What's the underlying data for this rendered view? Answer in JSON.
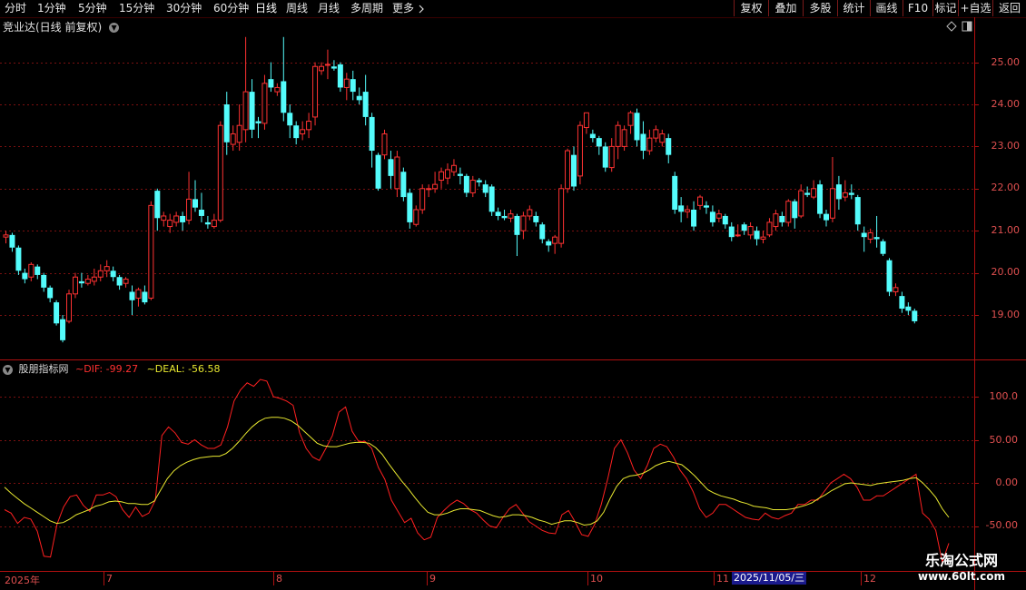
{
  "toolbar": {
    "periods": [
      "分时",
      "1分钟",
      "5分钟",
      "15分钟",
      "30分钟",
      "60分钟",
      "日线",
      "周线",
      "月线",
      "多周期",
      "更多"
    ],
    "active_period": "日线",
    "more_icon": "chevron-right-icon",
    "right_buttons": [
      "复权",
      "叠加",
      "多股",
      "统计",
      "画线",
      "F10",
      "标记",
      "+自选",
      "返回"
    ]
  },
  "stock": {
    "title": "竞业达(日线 前复权)",
    "title_icon": "chevron-down-icon"
  },
  "indicator": {
    "name": "股朋指标网",
    "dif_label": "~DIF: -99.27",
    "deal_label": "~DEAL: -56.58"
  },
  "price_axis": [
    "25.00",
    "24.00",
    "23.00",
    "22.00",
    "21.00",
    "20.00",
    "19.00"
  ],
  "ind_axis": [
    "100.0",
    "50.00",
    "0.00",
    "-50.00"
  ],
  "dates": {
    "year": "2025年",
    "months": [
      "7",
      "8",
      "9",
      "10",
      "11",
      "12"
    ],
    "cursor": "2025/11/05/三"
  },
  "colors": {
    "up": "#ff3232",
    "down": "#54fcfc",
    "dif": "#ff2020",
    "deal": "#e8e830",
    "axis": "#b01010",
    "grid": "#7a1010"
  },
  "watermark": {
    "title": "乐淘公式网",
    "url": "www.60lt.com"
  },
  "chart_data": [
    {
      "type": "candlestick",
      "title": "竞业达(日线 前复权)",
      "ylim": [
        18.2,
        25.6
      ],
      "y_ticks": [
        19,
        20,
        21,
        22,
        23,
        24,
        25
      ],
      "x_ticks": [
        "7",
        "8",
        "9",
        "10",
        "11",
        "12"
      ],
      "candles": [
        [
          20.85,
          20.9,
          20.7,
          21.0
        ],
        [
          20.9,
          20.6,
          20.5,
          20.95
        ],
        [
          20.6,
          20.05,
          19.95,
          20.65
        ],
        [
          20.0,
          19.85,
          19.75,
          20.1
        ],
        [
          19.9,
          20.2,
          19.8,
          20.25
        ],
        [
          20.15,
          19.95,
          19.85,
          20.2
        ],
        [
          19.95,
          19.65,
          19.55,
          20.0
        ],
        [
          19.65,
          19.4,
          19.3,
          19.7
        ],
        [
          19.3,
          18.8,
          18.75,
          19.35
        ],
        [
          18.9,
          18.4,
          18.35,
          19.0
        ],
        [
          18.85,
          19.5,
          18.8,
          19.6
        ],
        [
          19.5,
          19.9,
          19.4,
          20.0
        ],
        [
          19.8,
          19.75,
          19.65,
          20.0
        ],
        [
          19.75,
          19.85,
          19.7,
          19.95
        ],
        [
          19.8,
          19.9,
          19.7,
          20.1
        ],
        [
          19.9,
          20.05,
          19.8,
          20.2
        ],
        [
          20.05,
          20.15,
          19.9,
          20.3
        ],
        [
          20.05,
          19.9,
          19.8,
          20.15
        ],
        [
          19.9,
          19.7,
          19.6,
          19.95
        ],
        [
          19.75,
          19.85,
          19.65,
          19.9
        ],
        [
          19.55,
          19.35,
          19.0,
          19.7
        ],
        [
          19.4,
          19.6,
          19.2,
          19.65
        ],
        [
          19.55,
          19.3,
          19.25,
          19.7
        ],
        [
          19.4,
          21.6,
          19.35,
          21.7
        ],
        [
          21.95,
          21.3,
          21.0,
          22.0
        ],
        [
          21.25,
          21.35,
          21.1,
          21.45
        ],
        [
          21.1,
          21.25,
          20.95,
          21.4
        ],
        [
          21.2,
          21.35,
          21.1,
          21.45
        ],
        [
          21.35,
          21.2,
          21.0,
          21.45
        ],
        [
          21.25,
          21.75,
          21.15,
          22.4
        ],
        [
          21.75,
          21.55,
          21.45,
          22.2
        ],
        [
          21.5,
          21.35,
          21.2,
          21.9
        ],
        [
          21.2,
          21.15,
          21.05,
          21.35
        ],
        [
          21.1,
          21.25,
          21.05,
          21.4
        ],
        [
          21.25,
          23.5,
          21.2,
          23.6
        ],
        [
          24.0,
          23.1,
          22.8,
          24.3
        ],
        [
          23.05,
          23.3,
          22.9,
          23.5
        ],
        [
          23.1,
          23.5,
          22.9,
          24.0
        ],
        [
          23.4,
          24.3,
          23.1,
          25.6
        ],
        [
          24.3,
          23.4,
          23.2,
          24.6
        ],
        [
          23.6,
          23.55,
          23.2,
          23.7
        ],
        [
          23.55,
          24.5,
          23.4,
          24.7
        ],
        [
          24.6,
          24.4,
          24.3,
          25.0
        ],
        [
          24.3,
          24.4,
          24.2,
          24.5
        ],
        [
          24.55,
          23.8,
          23.6,
          25.6
        ],
        [
          23.8,
          23.5,
          23.2,
          24.0
        ],
        [
          23.5,
          23.2,
          23.05,
          23.6
        ],
        [
          23.3,
          23.4,
          23.15,
          23.6
        ],
        [
          23.4,
          23.6,
          23.2,
          23.8
        ],
        [
          23.7,
          24.9,
          23.5,
          25.0
        ],
        [
          24.8,
          24.9,
          24.7,
          25.0
        ],
        [
          24.95,
          24.95,
          24.6,
          25.3
        ],
        [
          24.9,
          24.85,
          24.8,
          25.05
        ],
        [
          24.95,
          24.4,
          24.3,
          25.0
        ],
        [
          24.4,
          24.6,
          24.1,
          24.75
        ],
        [
          24.6,
          24.3,
          24.1,
          24.8
        ],
        [
          24.2,
          24.1,
          24.0,
          24.4
        ],
        [
          24.3,
          23.7,
          23.5,
          24.7
        ],
        [
          23.7,
          22.9,
          22.5,
          23.8
        ],
        [
          22.8,
          22.0,
          21.95,
          22.85
        ],
        [
          22.8,
          23.3,
          22.7,
          23.4
        ],
        [
          22.7,
          22.3,
          22.0,
          22.9
        ],
        [
          22.0,
          22.75,
          21.8,
          22.9
        ],
        [
          22.4,
          21.8,
          21.7,
          22.5
        ],
        [
          21.9,
          21.2,
          21.05,
          22.0
        ],
        [
          21.15,
          21.5,
          21.1,
          21.6
        ],
        [
          21.5,
          22.0,
          21.4,
          22.1
        ],
        [
          22.0,
          22.0,
          21.8,
          22.1
        ],
        [
          22.0,
          22.1,
          21.9,
          22.4
        ],
        [
          22.2,
          22.4,
          22.0,
          22.5
        ],
        [
          22.25,
          22.45,
          22.1,
          22.6
        ],
        [
          22.4,
          22.55,
          22.3,
          22.7
        ],
        [
          22.35,
          22.3,
          22.1,
          22.5
        ],
        [
          22.3,
          21.9,
          21.8,
          22.35
        ],
        [
          21.9,
          22.2,
          21.8,
          22.3
        ],
        [
          22.2,
          22.15,
          22.05,
          22.25
        ],
        [
          22.1,
          21.9,
          21.8,
          22.2
        ],
        [
          22.05,
          21.45,
          21.35,
          22.1
        ],
        [
          21.45,
          21.35,
          21.25,
          21.55
        ],
        [
          21.35,
          21.3,
          21.25,
          21.5
        ],
        [
          21.3,
          21.4,
          21.2,
          21.5
        ],
        [
          21.35,
          20.9,
          20.4,
          21.4
        ],
        [
          21.0,
          21.35,
          20.8,
          21.45
        ],
        [
          21.35,
          21.5,
          21.25,
          21.6
        ],
        [
          21.35,
          21.2,
          21.1,
          21.45
        ],
        [
          21.15,
          20.8,
          20.7,
          21.2
        ],
        [
          20.75,
          20.65,
          20.5,
          20.8
        ],
        [
          20.7,
          20.85,
          20.45,
          20.9
        ],
        [
          20.7,
          22.0,
          20.6,
          22.1
        ],
        [
          22.0,
          22.9,
          21.9,
          22.95
        ],
        [
          22.8,
          22.05,
          21.95,
          23.0
        ],
        [
          22.3,
          23.5,
          22.1,
          23.6
        ],
        [
          23.45,
          23.8,
          23.3,
          23.8
        ],
        [
          23.3,
          23.2,
          23.1,
          23.4
        ],
        [
          23.2,
          23.0,
          22.8,
          23.25
        ],
        [
          23.0,
          22.5,
          22.4,
          23.1
        ],
        [
          22.5,
          23.0,
          22.4,
          23.2
        ],
        [
          23.0,
          23.5,
          22.7,
          23.6
        ],
        [
          23.0,
          23.4,
          22.9,
          23.5
        ],
        [
          23.5,
          23.8,
          23.3,
          23.85
        ],
        [
          23.8,
          23.15,
          23.0,
          23.9
        ],
        [
          23.3,
          22.9,
          22.7,
          23.6
        ],
        [
          22.9,
          23.2,
          22.8,
          23.4
        ],
        [
          23.2,
          23.4,
          23.1,
          23.5
        ],
        [
          23.1,
          23.3,
          23.0,
          23.4
        ],
        [
          23.2,
          22.8,
          22.6,
          23.3
        ],
        [
          22.3,
          21.5,
          21.4,
          22.4
        ],
        [
          21.6,
          21.45,
          21.2,
          21.8
        ],
        [
          21.45,
          21.5,
          21.3,
          21.6
        ],
        [
          21.5,
          21.1,
          21.0,
          21.7
        ],
        [
          21.6,
          21.8,
          21.5,
          21.85
        ],
        [
          21.6,
          21.55,
          21.4,
          21.7
        ],
        [
          21.45,
          21.2,
          21.1,
          21.6
        ],
        [
          21.3,
          21.4,
          21.2,
          21.5
        ],
        [
          21.35,
          21.15,
          21.05,
          21.4
        ],
        [
          21.1,
          20.85,
          20.75,
          21.2
        ],
        [
          20.9,
          20.9,
          20.85,
          21.15
        ],
        [
          21.15,
          21.0,
          20.9,
          21.2
        ],
        [
          20.9,
          21.1,
          20.8,
          21.2
        ],
        [
          21.0,
          20.8,
          20.65,
          21.1
        ],
        [
          20.8,
          20.85,
          20.7,
          21.0
        ],
        [
          20.9,
          21.2,
          20.85,
          21.3
        ],
        [
          21.1,
          21.4,
          21.0,
          21.5
        ],
        [
          21.35,
          21.2,
          21.1,
          21.45
        ],
        [
          21.2,
          21.7,
          21.1,
          21.75
        ],
        [
          21.7,
          21.3,
          21.05,
          21.75
        ],
        [
          21.35,
          21.95,
          21.3,
          22.1
        ],
        [
          21.9,
          21.85,
          21.8,
          22.05
        ],
        [
          21.8,
          22.0,
          21.75,
          22.2
        ],
        [
          22.1,
          21.4,
          21.3,
          22.2
        ],
        [
          21.4,
          21.25,
          21.1,
          21.5
        ],
        [
          21.3,
          22.0,
          21.2,
          22.75
        ],
        [
          22.1,
          21.75,
          21.5,
          22.3
        ],
        [
          21.8,
          21.9,
          21.7,
          22.2
        ],
        [
          21.9,
          21.85,
          21.75,
          22.1
        ],
        [
          21.8,
          21.15,
          21.0,
          21.85
        ],
        [
          20.95,
          20.85,
          20.5,
          21.1
        ],
        [
          20.8,
          20.95,
          20.7,
          21.05
        ],
        [
          20.85,
          20.8,
          20.6,
          21.35
        ],
        [
          20.75,
          20.45,
          20.4,
          20.8
        ],
        [
          20.3,
          19.55,
          19.45,
          20.35
        ],
        [
          19.55,
          19.65,
          19.45,
          19.75
        ],
        [
          19.45,
          19.15,
          19.05,
          19.55
        ],
        [
          19.2,
          19.1,
          19.0,
          19.3
        ],
        [
          19.1,
          18.85,
          18.8,
          19.15
        ]
      ]
    },
    {
      "type": "line",
      "title": "股朋指标网",
      "ylim": [
        -92,
        138
      ],
      "y_ticks": [
        100,
        50,
        0,
        -50
      ],
      "series": [
        {
          "name": "DIF",
          "values": [
            -31,
            -35,
            -47,
            -40,
            -42,
            -56,
            -85,
            -86,
            -48,
            -28,
            -16,
            -14,
            -26,
            -33,
            -14,
            -14,
            -11,
            -16,
            -31,
            -40,
            -28,
            -39,
            -35,
            -20,
            55,
            65,
            58,
            47,
            45,
            50,
            44,
            40,
            40,
            44,
            65,
            95,
            108,
            116,
            112,
            120,
            118,
            100,
            98,
            95,
            90,
            58,
            40,
            30,
            26,
            40,
            55,
            82,
            88,
            60,
            48,
            48,
            40,
            18,
            4,
            -20,
            -33,
            -46,
            -41,
            -58,
            -66,
            -63,
            -40,
            -32,
            -25,
            -20,
            -24,
            -31,
            -35,
            -43,
            -50,
            -52,
            -40,
            -30,
            -25,
            -35,
            -45,
            -50,
            -55,
            -58,
            -59,
            -37,
            -32,
            -45,
            -60,
            -62,
            -48,
            -25,
            5,
            40,
            50,
            35,
            15,
            5,
            20,
            40,
            45,
            42,
            30,
            15,
            5,
            -10,
            -30,
            -40,
            -35,
            -25,
            -25,
            -30,
            -35,
            -40,
            -42,
            -43,
            -35,
            -40,
            -42,
            -38,
            -35,
            -25,
            -25,
            -20,
            -20,
            -10,
            0,
            5,
            10,
            5,
            -5,
            -20,
            -20,
            -15,
            -15,
            -10,
            -5,
            0,
            5,
            10,
            -35,
            -42,
            -55,
            -92,
            -70
          ]
        },
        {
          "name": "DEAL",
          "values": [
            -5,
            -12,
            -18,
            -24,
            -29,
            -34,
            -39,
            -44,
            -47,
            -46,
            -42,
            -37,
            -34,
            -31,
            -27,
            -25,
            -22,
            -21,
            -22,
            -24,
            -24,
            -25,
            -25,
            -21,
            -8,
            5,
            14,
            20,
            24,
            27,
            29,
            30,
            31,
            31,
            34,
            40,
            48,
            57,
            65,
            71,
            75,
            76,
            76,
            75,
            72,
            67,
            60,
            53,
            46,
            43,
            42,
            42,
            44,
            46,
            47,
            47,
            46,
            41,
            33,
            22,
            12,
            2,
            -7,
            -17,
            -26,
            -34,
            -37,
            -37,
            -35,
            -32,
            -30,
            -30,
            -31,
            -32,
            -35,
            -38,
            -40,
            -39,
            -37,
            -37,
            -38,
            -40,
            -43,
            -45,
            -48,
            -46,
            -44,
            -44,
            -46,
            -49,
            -48,
            -44,
            -34,
            -18,
            -4,
            5,
            8,
            9,
            11,
            15,
            20,
            23,
            25,
            23,
            21,
            15,
            8,
            0,
            -8,
            -12,
            -15,
            -17,
            -19,
            -22,
            -24,
            -27,
            -28,
            -29,
            -31,
            -31,
            -31,
            -30,
            -28,
            -26,
            -23,
            -18,
            -14,
            -9,
            -5,
            -1,
            0,
            -1,
            -2,
            -3,
            -1,
            0,
            1,
            2,
            3,
            5,
            6,
            0,
            -8,
            -17,
            -30,
            -40
          ]
        }
      ]
    }
  ]
}
